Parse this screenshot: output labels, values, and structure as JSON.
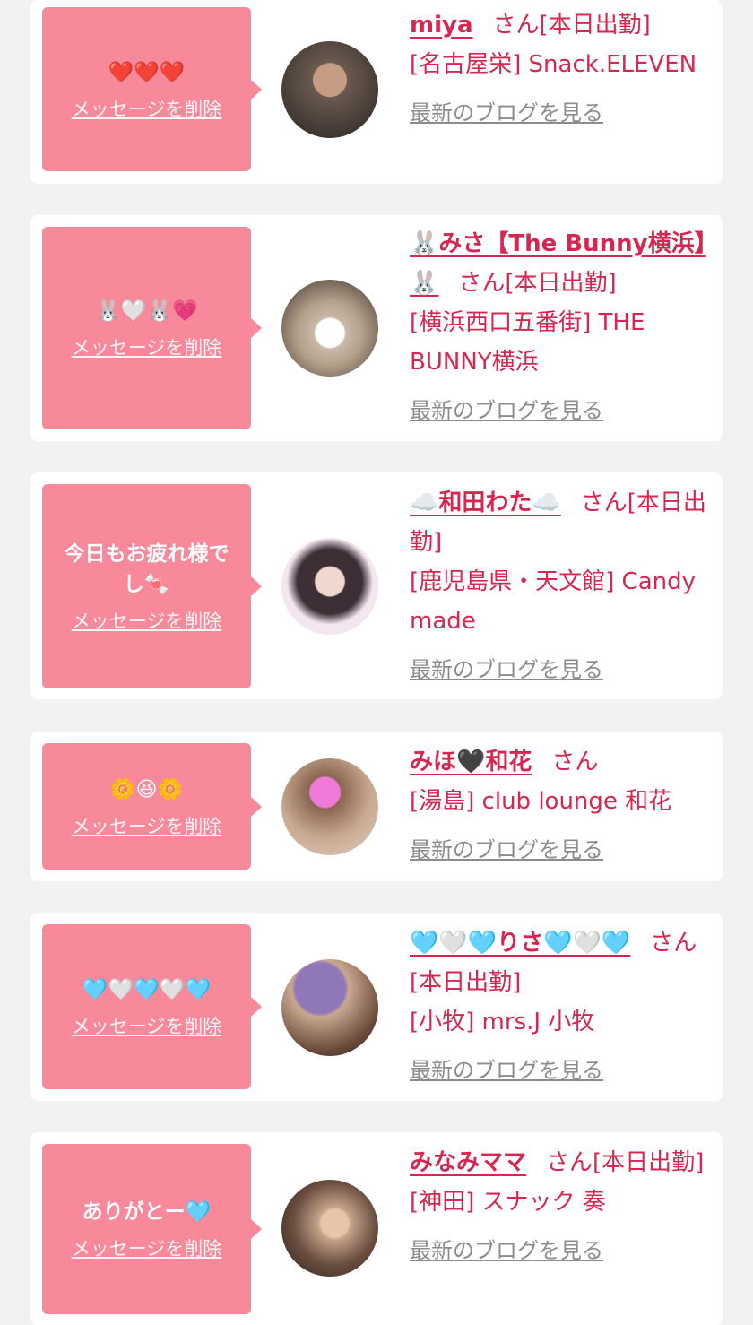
{
  "cards": [
    {
      "message": "❤️❤️❤️",
      "delete_label": "メッセージを削除",
      "name": "miya",
      "san": "さん",
      "status": "[本日出勤]",
      "shop": "[名古屋栄] Snack.ELEVEN",
      "blog": "最新のブログを見る",
      "avatar_colors": [
        "#6a5a50",
        "#2a2420"
      ]
    },
    {
      "message": "🐰🤍🐰💗",
      "delete_label": "メッセージを削除",
      "name": "🐰みさ【The Bunny横浜】🐰",
      "san": "さん",
      "status": "[本日出勤]",
      "shop": "[横浜西口五番街] THE BUNNY横浜",
      "blog": "最新のブログを見る",
      "avatar_colors": [
        "#b2a08a",
        "#3c2e2a"
      ]
    },
    {
      "message": "今日もお疲れ様でし🍬",
      "delete_label": "メッセージを削除",
      "name": "☁️和田わた☁️",
      "san": "さん",
      "status": "[本日出勤]",
      "shop": "[鹿児島県・天文館] Candy made",
      "blog": "最新のブログを見る",
      "avatar_colors": [
        "#f3e6ee",
        "#3e2e36"
      ]
    },
    {
      "message": "🌼😆🌼",
      "delete_label": "メッセージを削除",
      "name": "みほ🖤和花",
      "san": "さん",
      "status": "",
      "shop": "[湯島] club lounge 和花",
      "blog": "最新のブログを見る",
      "avatar_colors": [
        "#e2d0c0",
        "#8a6650"
      ]
    },
    {
      "message": "🩵🤍🩵🤍🩵",
      "delete_label": "メッセージを削除",
      "name": "🩵🤍🩵りさ🩵🤍🩵",
      "san": "さん",
      "status": "[本日出勤]",
      "shop": "[小牧] mrs.J 小牧",
      "blog": "最新のブログを見る",
      "avatar_colors": [
        "#8f77b8",
        "#6a4a3a"
      ]
    },
    {
      "message": "ありがとー🩵",
      "delete_label": "メッセージを削除",
      "name": "みなみママ",
      "san": "さん",
      "status": "[本日出勤]",
      "shop": "[神田] スナック 奏",
      "blog": "最新のブログを見る",
      "avatar_colors": [
        "#c4a28a",
        "#2a201c"
      ]
    }
  ]
}
